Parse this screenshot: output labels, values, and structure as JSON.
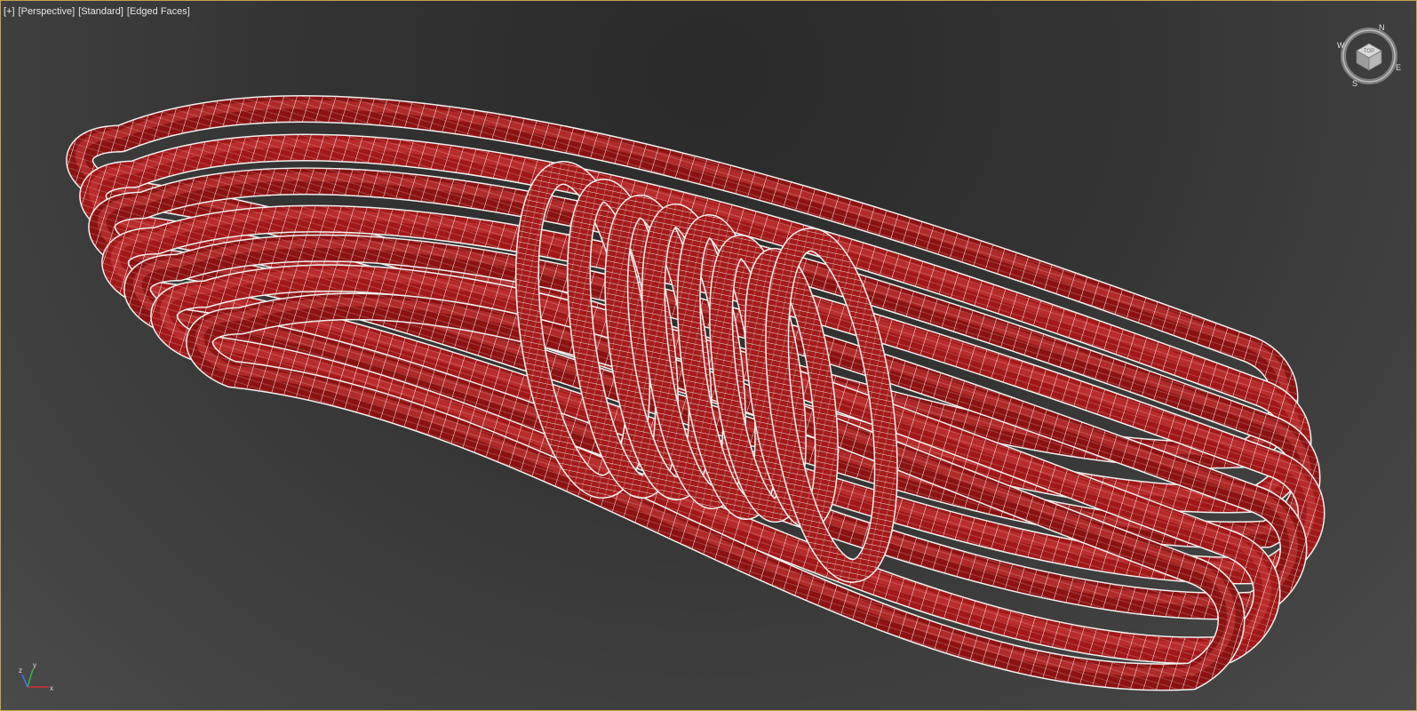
{
  "viewport": {
    "labels": [
      "[+]",
      "[Perspective]",
      "[Standard]",
      "[Edged Faces]"
    ]
  },
  "viewcube": {
    "face_label": "TOP",
    "compass": {
      "north": "N",
      "south": "S",
      "east": "E",
      "west": "W"
    }
  },
  "axis_tripod": {
    "x": "x",
    "y": "y",
    "z": "z"
  },
  "object": {
    "name": "rope coil",
    "color": "#9b1414",
    "wire_color": "#ffffff"
  },
  "colors": {
    "rope_dark": "#6e0c0c",
    "rope_base": "#a81a1a",
    "rope_light": "#d64a4a",
    "wire": "#f2f2f2",
    "viewport_border": "#c8a24a"
  }
}
